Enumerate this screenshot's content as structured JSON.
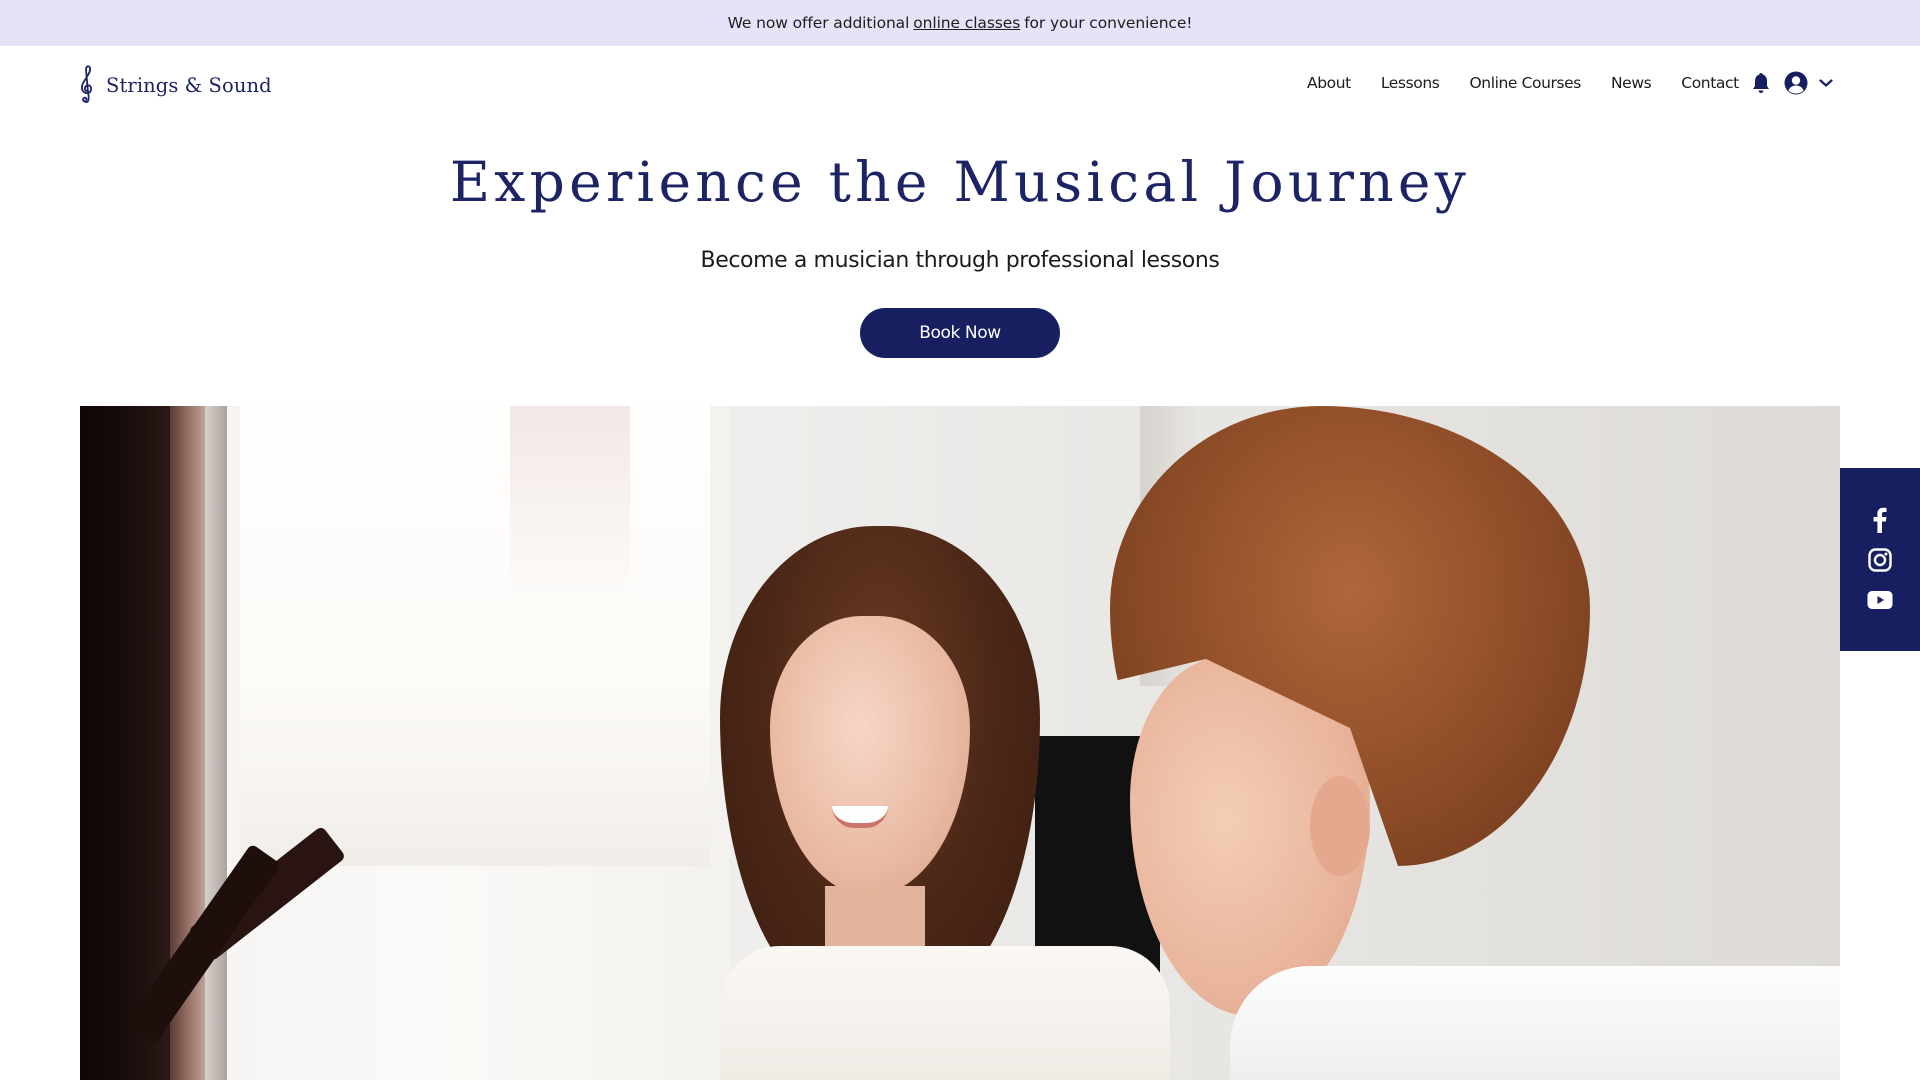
{
  "announcement": {
    "prefix": "We now offer additional",
    "link_text": "online classes",
    "suffix": "for your convenience!"
  },
  "header": {
    "logo_text": "Strings & Sound",
    "logo_icon": "treble-clef-icon",
    "nav": [
      {
        "label": "About"
      },
      {
        "label": "Lessons"
      },
      {
        "label": "Online Courses"
      },
      {
        "label": "News"
      },
      {
        "label": "Contact"
      }
    ],
    "icons": [
      "bell-icon",
      "user-avatar-icon",
      "chevron-down-icon"
    ]
  },
  "hero": {
    "title": "Experience the Musical Journey",
    "subtitle": "Become a musician through professional lessons",
    "cta_label": "Book Now",
    "image_alt": "Smiling music teacher with a student at a piano"
  },
  "social": [
    {
      "name": "Facebook",
      "icon": "facebook-icon"
    },
    {
      "name": "Instagram",
      "icon": "instagram-icon"
    },
    {
      "name": "YouTube",
      "icon": "youtube-icon"
    }
  ],
  "colors": {
    "brand_navy": "#171f60",
    "title_navy": "#1c2466",
    "banner_lavender": "#e6e2f8"
  }
}
